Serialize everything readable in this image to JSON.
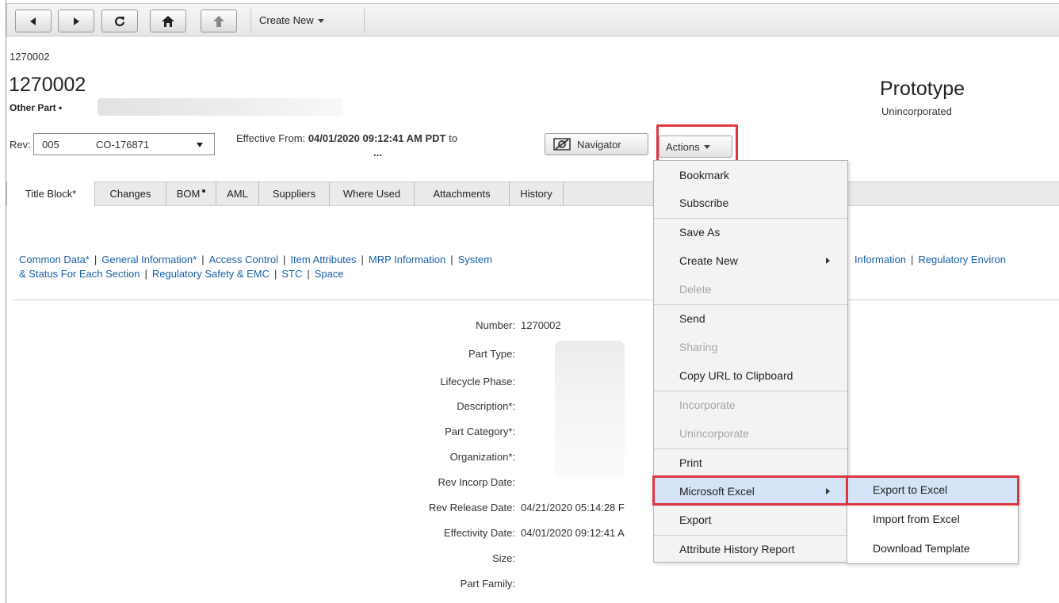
{
  "toolbar": {
    "buttons": [
      "back-arrow-icon",
      "forward-arrow-icon",
      "refresh-icon",
      "home-icon",
      "up-arrow-icon"
    ],
    "create_new": "Create New"
  },
  "header": {
    "small_number": "1270002",
    "number": "1270002",
    "subtitle": "Other Part •",
    "status": "Prototype",
    "status_sub": "Unincorporated"
  },
  "rev": {
    "label": "Rev:",
    "value": "005",
    "co": "CO-176871"
  },
  "effective": {
    "label": "Effective From:",
    "value": "04/01/2020 09:12:41 AM PDT",
    "suffix": "to",
    "dots": "..."
  },
  "buttons": {
    "navigator": "Navigator",
    "actions": "Actions"
  },
  "tabs": [
    {
      "label": "Title Block*",
      "active": true
    },
    {
      "label": "Changes"
    },
    {
      "label": "BOM"
    },
    {
      "label": "AML"
    },
    {
      "label": "Suppliers"
    },
    {
      "label": "Where Used"
    },
    {
      "label": "Attachments"
    },
    {
      "label": "History"
    }
  ],
  "sections": {
    "line1": [
      "Common Data*",
      "General Information*",
      "Access Control",
      "Item Attributes",
      "MRP Information",
      "System"
    ],
    "line1_tail": [
      "Information",
      "Regulatory Environ"
    ],
    "line2_lead": "& Status For Each Section",
    "line2": [
      "Regulatory Safety & EMC",
      "STC",
      "Space"
    ]
  },
  "fields": [
    {
      "label": "Number:",
      "value": "1270002"
    },
    {
      "label": "Part Type:",
      "value": ""
    },
    {
      "label": "Lifecycle Phase:",
      "value": ""
    },
    {
      "label": "Description*:",
      "value": ""
    },
    {
      "label": "Part Category*:",
      "value": ""
    },
    {
      "label": "Organization*:",
      "value": ""
    },
    {
      "label": "Rev Incorp Date:",
      "value": ""
    },
    {
      "label": "Rev Release Date:",
      "value": "04/21/2020 05:14:28 F"
    },
    {
      "label": "Effectivity Date:",
      "value": "04/01/2020 09:12:41 A"
    },
    {
      "label": "Size:",
      "value": ""
    },
    {
      "label": "Part Family:",
      "value": ""
    }
  ],
  "menu": {
    "items": [
      {
        "label": "Bookmark"
      },
      {
        "label": "Subscribe"
      },
      {
        "label": "Save As"
      },
      {
        "label": "Create New",
        "submenu": true
      },
      {
        "label": "Delete",
        "disabled": true
      },
      {
        "label": "Send"
      },
      {
        "label": "Sharing",
        "disabled": true
      },
      {
        "label": "Copy URL to Clipboard"
      },
      {
        "label": "Incorporate",
        "disabled": true
      },
      {
        "label": "Unincorporate",
        "disabled": true
      },
      {
        "label": "Print"
      },
      {
        "label": "Microsoft Excel",
        "submenu": true,
        "highlighted": true
      },
      {
        "label": "Export"
      },
      {
        "label": "Attribute History Report"
      }
    ]
  },
  "submenu": {
    "items": [
      {
        "label": "Export to Excel",
        "highlighted": true
      },
      {
        "label": "Import from Excel"
      },
      {
        "label": "Download Template"
      }
    ]
  },
  "colors": {
    "link": "#1a5fa6",
    "highlight": "#d4e3f5",
    "annotation_red": "#e0363f"
  }
}
